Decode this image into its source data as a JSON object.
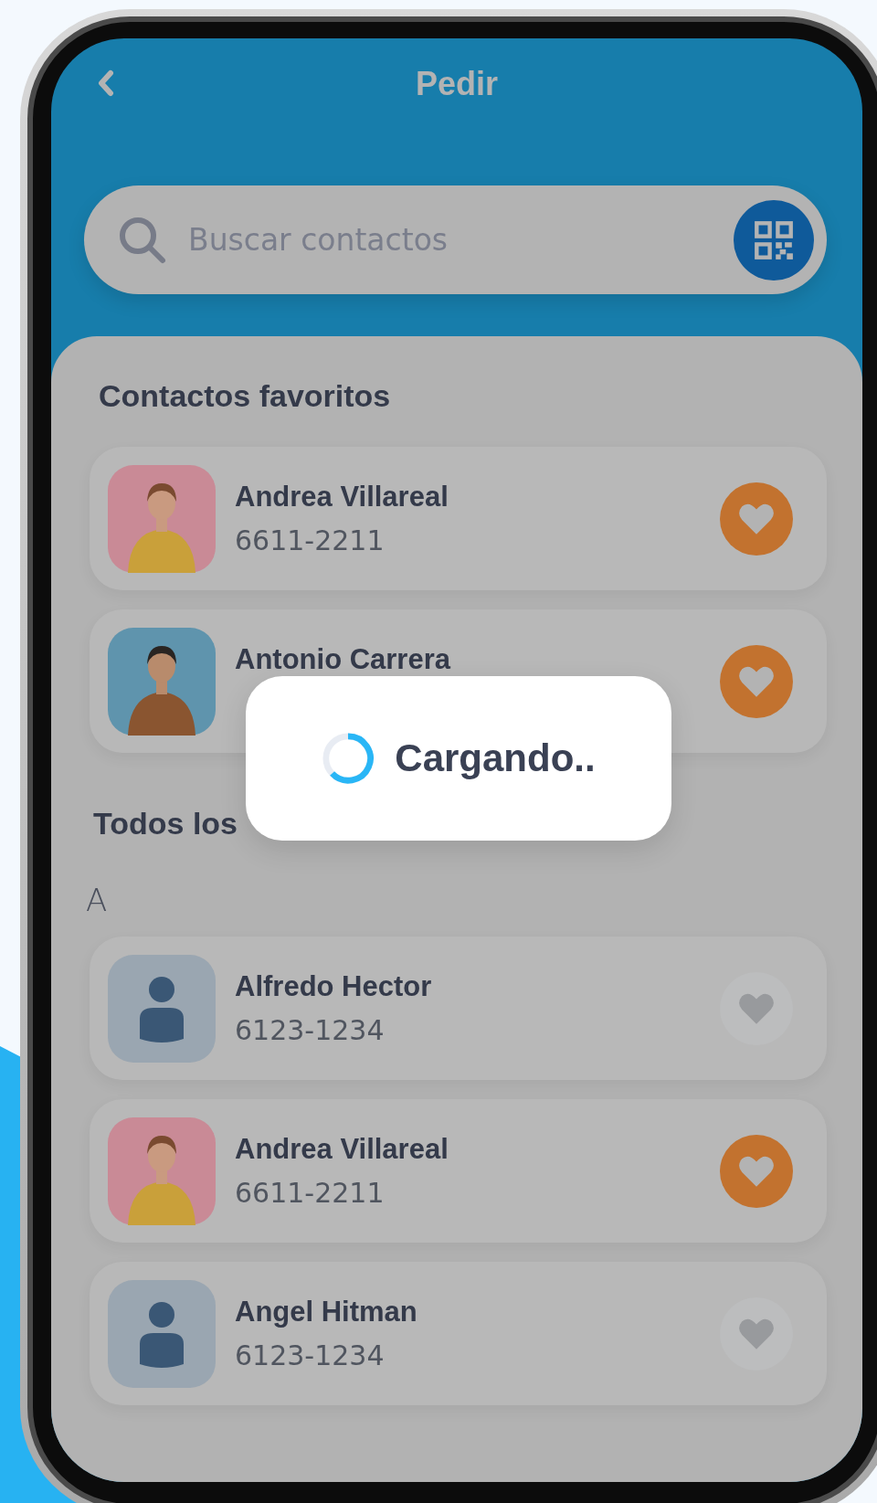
{
  "header": {
    "title": "Pedir"
  },
  "search": {
    "placeholder": "Buscar contactos"
  },
  "favorites": {
    "title": "Contactos favoritos",
    "contacts": [
      {
        "name": "Andrea Villareal",
        "phone": "6611-2211",
        "kind": "picture",
        "favorite": true
      },
      {
        "name": "Antonio Carrera",
        "kind": "picture",
        "favorite": true
      }
    ]
  },
  "all": {
    "title": "Todos los",
    "groups": [
      {
        "letter": "A",
        "contacts": [
          {
            "name": "Alfredo Hector",
            "phone": "6123-1234",
            "kind": "silhouette",
            "favorite": false
          },
          {
            "name": "Andrea Villareal",
            "phone": "6611-2211",
            "kind": "picture",
            "favorite": true
          },
          {
            "name": "Angel Hitman",
            "phone": "6123-1234",
            "kind": "silhouette",
            "favorite": false
          }
        ]
      }
    ]
  },
  "loading": {
    "text": "Cargando.."
  }
}
